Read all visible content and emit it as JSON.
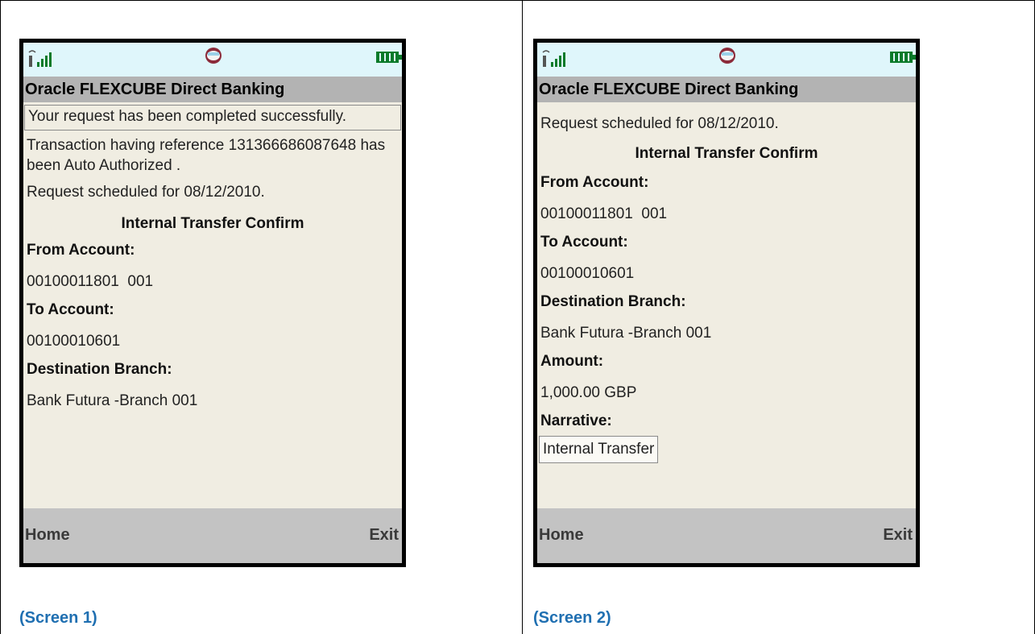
{
  "colors": {
    "caption": "#1f6fb1",
    "status_bar": "#dff6fb",
    "title_bar": "#b3b3b3",
    "screen_bg": "#f0ede2",
    "softkey_bar": "#c3c3c3"
  },
  "screens": [
    {
      "status_icons": [
        "signal-icon",
        "globe-icon",
        "battery-icon"
      ],
      "title": "Oracle FLEXCUBE Direct Banking",
      "success_message": "Your request has been completed successfully.",
      "transaction_message": "Transaction having reference 131366686087648 has been Auto Authorized .",
      "scheduled_message": "Request scheduled for 08/12/2010.",
      "section_title": "Internal Transfer Confirm",
      "from_account_label": "From Account:",
      "from_account_value": "00100011801  001",
      "to_account_label": "To Account:",
      "to_account_value": "00100010601",
      "destination_branch_label": "Destination Branch:",
      "destination_branch_value": "Bank Futura -Branch 001",
      "softkey_left": "Home",
      "softkey_right": "Exit",
      "caption": "(Screen 1)"
    },
    {
      "status_icons": [
        "signal-icon",
        "globe-icon",
        "battery-icon"
      ],
      "title": "Oracle FLEXCUBE Direct Banking",
      "scheduled_message": "Request scheduled for 08/12/2010.",
      "section_title": "Internal Transfer Confirm",
      "from_account_label": "From Account:",
      "from_account_value": "00100011801  001",
      "to_account_label": "To Account:",
      "to_account_value": "00100010601",
      "destination_branch_label": "Destination Branch:",
      "destination_branch_value": "Bank Futura -Branch 001",
      "amount_label": "Amount:",
      "amount_value": "1,000.00 GBP",
      "narrative_label": "Narrative:",
      "narrative_value": "Internal Transfer",
      "softkey_left": "Home",
      "softkey_right": "Exit",
      "caption": "(Screen 2)"
    }
  ]
}
